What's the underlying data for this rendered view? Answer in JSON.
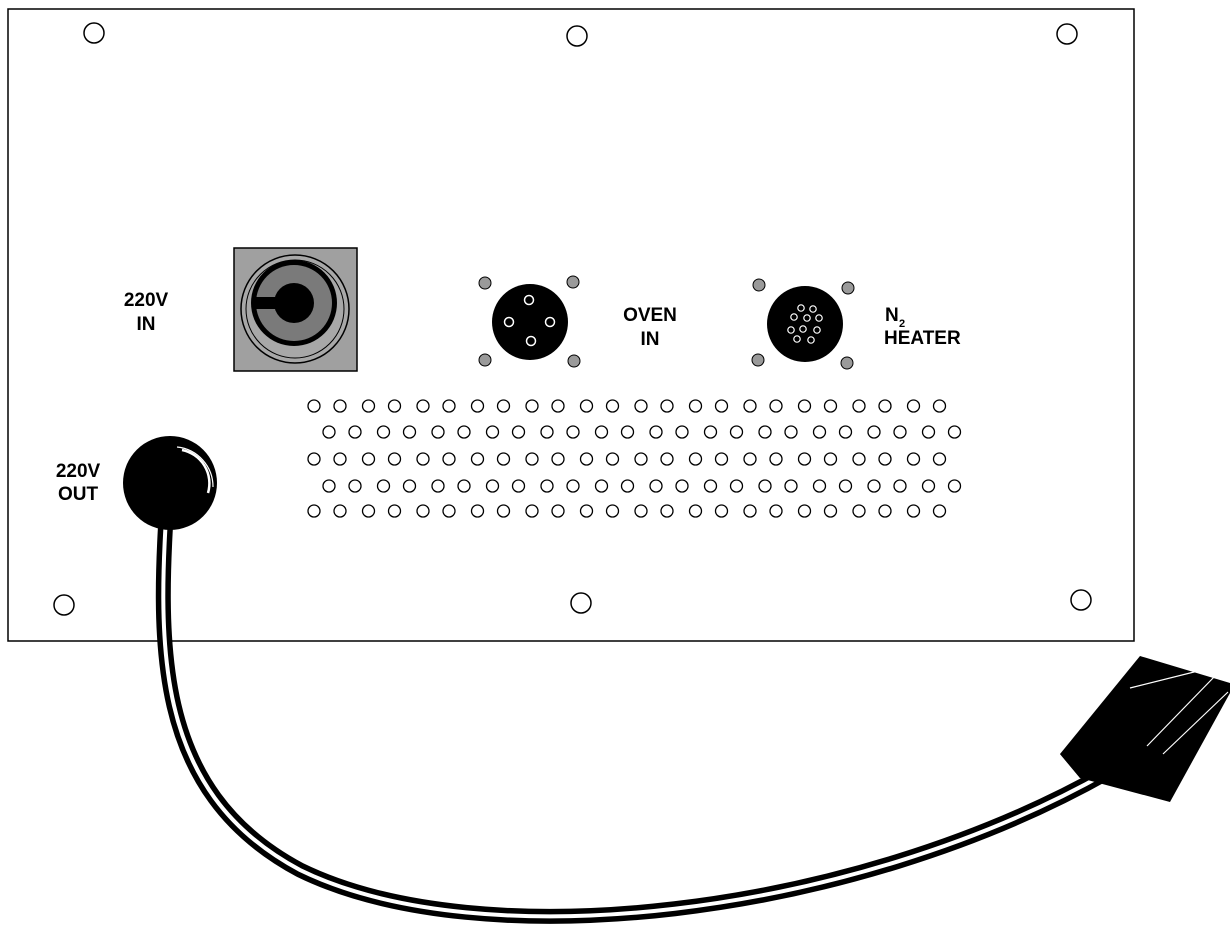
{
  "panel": {
    "labels": {
      "power_in": [
        "220V",
        "IN"
      ],
      "power_out": [
        "220V",
        "OUT"
      ],
      "oven_in": [
        "OVEN",
        "IN"
      ],
      "n2_heater": {
        "symbol": "N",
        "subscript": "2",
        "line2": "HEATER"
      }
    }
  },
  "colors": {
    "outline": "#000000",
    "panel_fill": "#ffffff",
    "socket_plate": "#a0a0a0",
    "socket_ring": "#808080",
    "screw_fill": "#9a9a9a",
    "connector_fill": "#000000"
  },
  "icons": {
    "mount_hole": "circle-outline",
    "vent_hole": "circle-outline",
    "power_inlet": "round-socket-on-square-plate",
    "power_outlet": "cable-gland-with-cord",
    "plug": "rectangular-plug"
  }
}
